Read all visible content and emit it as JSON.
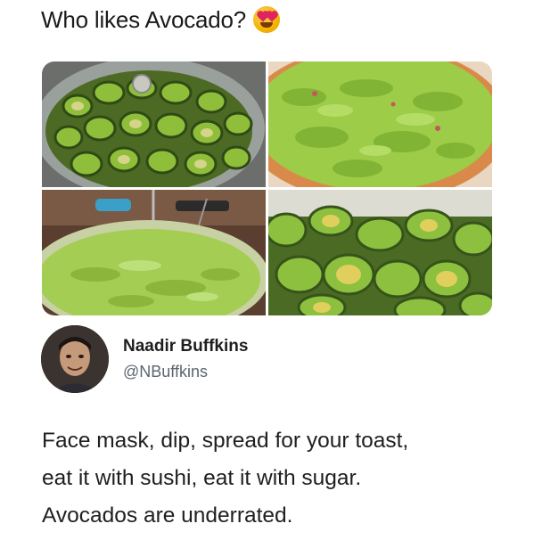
{
  "header": {
    "title": "Who likes Avocado?",
    "emoji_icon": "heart-eyes-emoji-icon"
  },
  "photos": [
    {
      "name": "photo-avocado-halves-bowl",
      "icon": "avocado-halves-image"
    },
    {
      "name": "photo-guacamole-bowl",
      "icon": "guacamole-image"
    },
    {
      "name": "photo-mashed-avocado-bowl",
      "icon": "mashed-avocado-image"
    },
    {
      "name": "photo-avocado-halves-pile",
      "icon": "avocado-halves-image"
    }
  ],
  "tweet": {
    "author_name": "Naadir Buffkins",
    "author_handle": "@NBuffkins",
    "lines": [
      "Face mask, dip, spread for your toast,",
      "eat it with sushi, eat it with sugar.",
      "Avocados  are underrated."
    ]
  },
  "colors": {
    "avocado_green": "#8fbf3a",
    "avocado_skin": "#3d5a1c",
    "pit_yellow": "#d9c24a",
    "text": "#1a1a1a",
    "handle_gray": "#5b6670"
  }
}
